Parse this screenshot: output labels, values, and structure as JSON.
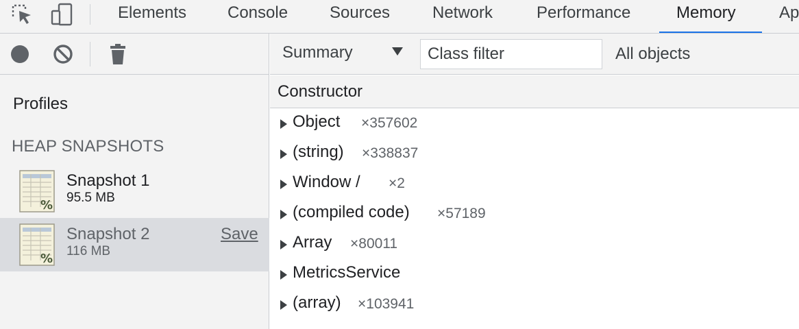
{
  "tabs": [
    "Elements",
    "Console",
    "Sources",
    "Network",
    "Performance",
    "Memory",
    "Ap"
  ],
  "active_tab": "Memory",
  "icons": {
    "inspect": "inspect-element-icon",
    "device": "device-toolbar-icon",
    "record": "record-icon",
    "clear": "clear-icon",
    "delete": "trash-icon",
    "snapshot": "heap-snapshot-icon",
    "expand": "expand-triangle-icon"
  },
  "sidebar": {
    "profiles_title": "Profiles",
    "section_title": "HEAP SNAPSHOTS",
    "snapshots": [
      {
        "name": "Snapshot 1",
        "size": "95.5 MB"
      },
      {
        "name": "Snapshot 2",
        "size": "116 MB",
        "action": "Save"
      }
    ]
  },
  "toolbar": {
    "view": "Summary",
    "class_filter_placeholder": "Class filter",
    "scope": "All objects"
  },
  "table": {
    "column": "Constructor",
    "rows": [
      {
        "name": "Object",
        "count": "×357602"
      },
      {
        "name": "(string)",
        "count": "×338837"
      },
      {
        "name": "Window /",
        "count": "×2"
      },
      {
        "name": "(compiled code)",
        "count": "×57189"
      },
      {
        "name": "Array",
        "count": "×80011"
      },
      {
        "name": "MetricsService",
        "count": ""
      },
      {
        "name": "(array)",
        "count": "×103941"
      }
    ]
  },
  "colors": {
    "accent": "#1a73e8",
    "panel": "#f3f3f3",
    "selected_row": "#dadce0",
    "border": "#cacdd1"
  }
}
